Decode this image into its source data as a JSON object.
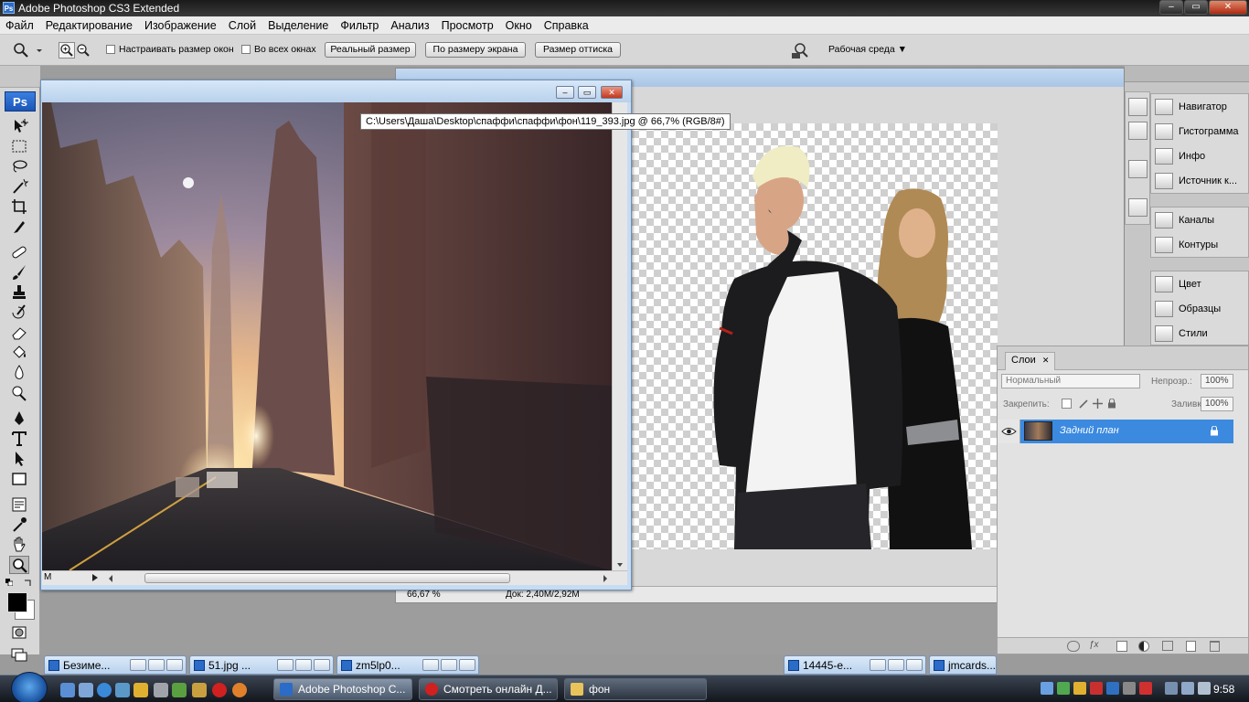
{
  "app": {
    "title": "Adobe Photoshop CS3 Extended",
    "ps_mark": "Ps"
  },
  "window_controls": {
    "minimize": "–",
    "maximize": "▭",
    "close": "✕"
  },
  "menu": [
    "Файл",
    "Редактирование",
    "Изображение",
    "Слой",
    "Выделение",
    "Фильтр",
    "Анализ",
    "Просмотр",
    "Окно",
    "Справка"
  ],
  "options_bar": {
    "resize_windows_label": "Настраивать размер окон",
    "all_windows_label": "Во всех окнах",
    "actual_pixels_button": "Реальный размер",
    "fit_screen_button": "По размеру экрана",
    "print_size_button": "Размер оттиска",
    "workspace_label": "Рабочая среда ▼"
  },
  "document_front": {
    "tooltip": "C:\\Users\\Даша\\Desktop\\спаффи\\спаффи\\фон\\119_393.jpg @ 66,7% (RGB/8#)",
    "status_fragment": "M"
  },
  "document_back": {
    "zoom": "66,67 %",
    "doc_info": "Док: 2,40М/2,92М"
  },
  "panels": {
    "group1": [
      "Навигатор",
      "Гистограмма",
      "Инфо",
      "Источник к..."
    ],
    "group2": [
      "Каналы",
      "Контуры"
    ],
    "group3": [
      "Цвет",
      "Образцы",
      "Стили"
    ]
  },
  "layers_panel": {
    "tab": "Слои",
    "blend_mode": "Нормальный",
    "opacity_label": "Непрозр.:",
    "opacity_value": "100%",
    "lock_label": "Закрепить:",
    "fill_label": "Заливка:",
    "fill_value": "100%",
    "layer_name": "Задний план"
  },
  "minimized_docs": [
    "Безиме...",
    "51.jpg ...",
    "zm5lp0...",
    "14445-e...",
    "jmcards..."
  ],
  "taskbar": {
    "tasks": [
      "Adobe Photoshop C...",
      "Смотреть онлайн Д...",
      "фон"
    ],
    "clock": "9:58"
  },
  "colors": {
    "accent": "#3b8ae0",
    "title_bar": "#1a1a1a",
    "taskbar": "#12161c"
  }
}
